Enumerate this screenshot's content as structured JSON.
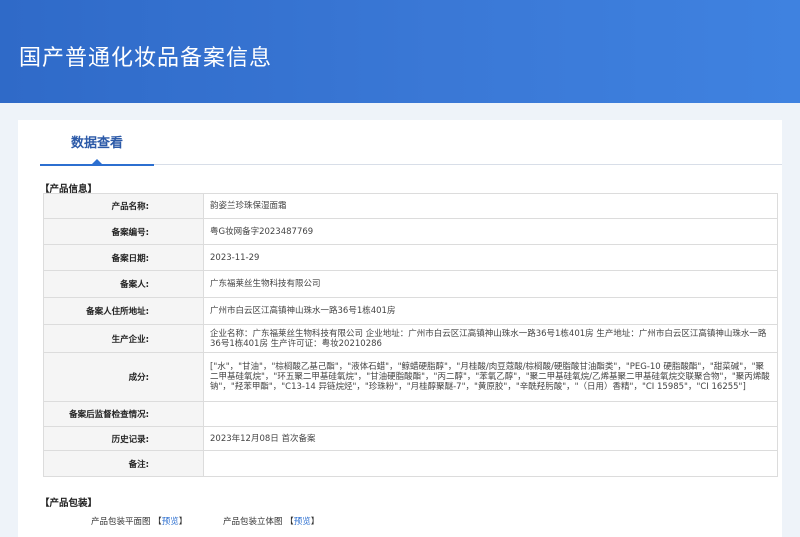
{
  "header": {
    "title": "国产普通化妆品备案信息"
  },
  "tabs": [
    {
      "label": "数据查看"
    }
  ],
  "product_info": {
    "section_title": "【产品信息】",
    "rows": [
      {
        "label": "产品名称:",
        "value": "韵姿兰珍珠保湿面霜"
      },
      {
        "label": "备案编号:",
        "value": "粤G妆网备字2023487769"
      },
      {
        "label": "备案日期:",
        "value": "2023-11-29"
      },
      {
        "label": "备案人:",
        "value": "广东福莱丝生物科技有限公司"
      },
      {
        "label": "备案人住所地址:",
        "value": "广州市白云区江高镇神山珠水一路36号1栋401房"
      },
      {
        "label": "生产企业:",
        "value": "企业名称：广东福莱丝生物科技有限公司 企业地址：广州市白云区江高镇神山珠水一路36号1栋401房 生产地址：广州市白云区江高镇神山珠水一路36号1栋401房 生产许可证：粤妆20210286"
      },
      {
        "label": "成分:",
        "value": "[\"水\"，\"甘油\"，\"棕榈酸乙基己酯\"，\"液体石蜡\"，\"鲸蜡硬脂醇\"，\"月桂酸/肉豆蔻酸/棕榈酸/硬脂酸甘油酯类\"，\"PEG-10 硬脂酸酯\"，\"甜菜碱\"，\"聚二甲基硅氧烷\"，\"环五聚二甲基硅氧烷\"，\"甘油硬脂酸酯\"，\"丙二醇\"，\"苯氧乙醇\"，\"聚二甲基硅氧烷/乙烯基聚二甲基硅氧烷交联聚合物\"，\"聚丙烯酸钠\"，\"羟苯甲酯\"，\"C13-14 异链烷烃\"，\"珍珠粉\"，\"月桂醇聚醚-7\"，\"黄原胶\"，\"辛酰羟肟酸\"，\"（日用）香精\"，\"CI 15985\"，\"CI 16255\"]"
      },
      {
        "label": "备案后监督检查情况:",
        "value": ""
      },
      {
        "label": "历史记录:",
        "value": "2023年12月08日 首次备案"
      },
      {
        "label": "备注:",
        "value": ""
      }
    ]
  },
  "packaging": {
    "section_title": "【产品包装】",
    "items": [
      {
        "label": "产品包装平面图",
        "bracket_open": "【",
        "link": "预览",
        "bracket_close": "】"
      },
      {
        "label": "产品包装立体图",
        "bracket_open": "【",
        "link": "预览",
        "bracket_close": "】"
      }
    ]
  },
  "colors": {
    "banner": "#3a78d6",
    "accent": "#2c6fd0",
    "label_bg": "#f5f5f5",
    "border": "#dcdcdc"
  }
}
